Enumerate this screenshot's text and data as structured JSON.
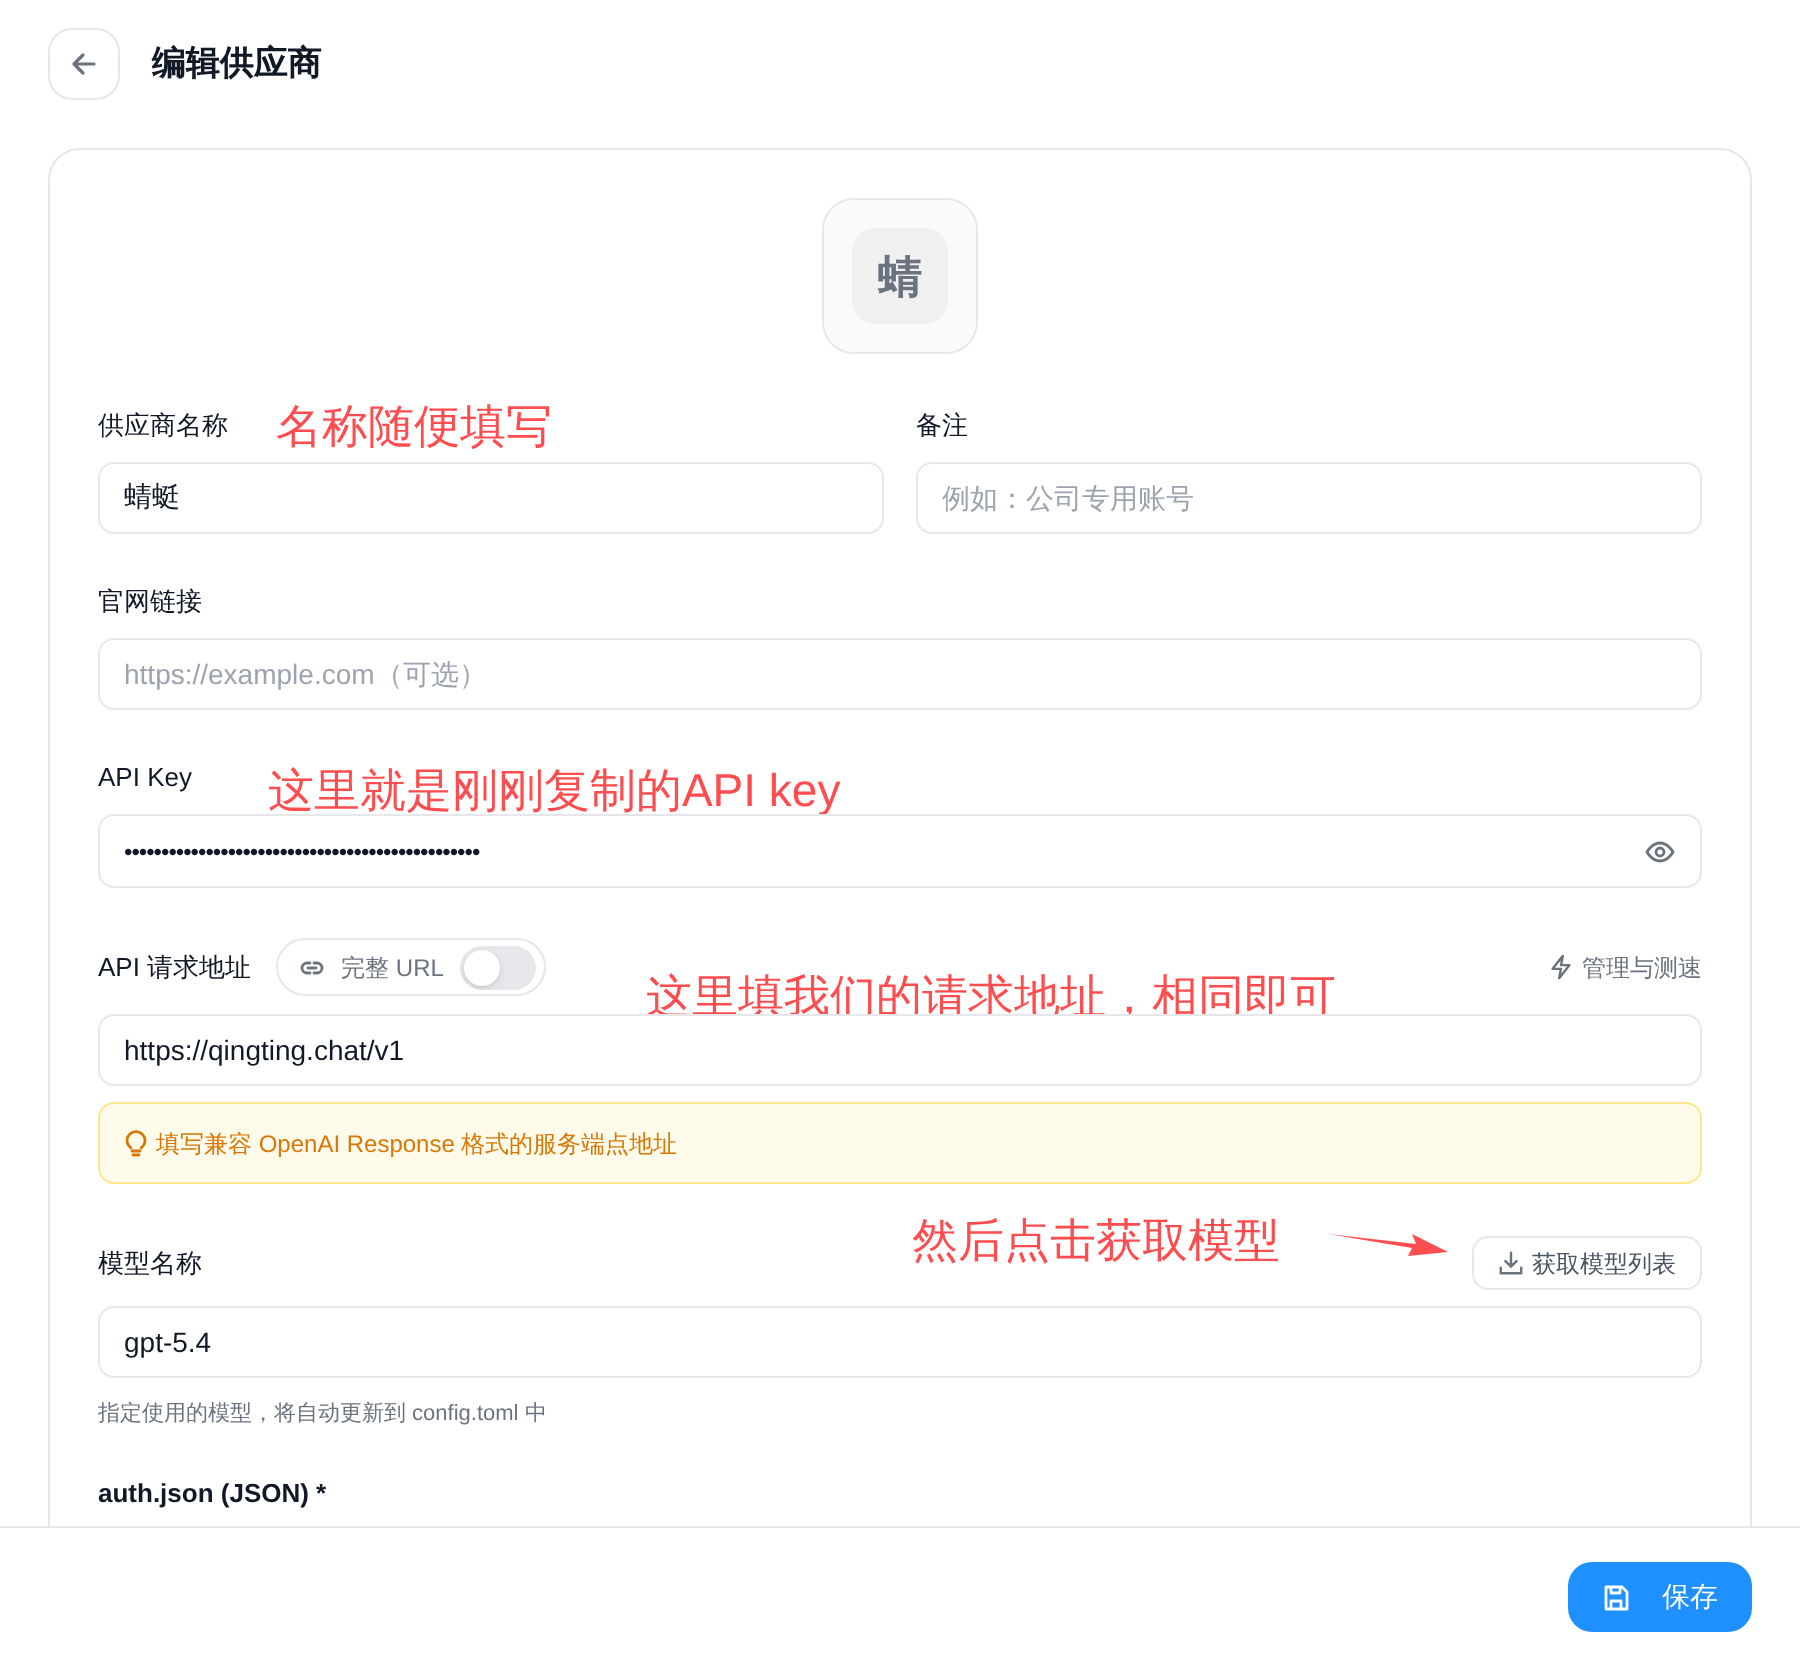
{
  "header": {
    "title": "编辑供应商"
  },
  "avatar": {
    "char": "蜻"
  },
  "fields_row": [
    {
      "label": "供应商名称",
      "value": "蜻蜓"
    },
    {
      "label": "备注",
      "placeholder": "例如：公司专用账号"
    }
  ],
  "website": {
    "label": "官网链接",
    "placeholder": "https://example.com（可选）"
  },
  "api_key": {
    "label": "API Key",
    "value": "••••••••••••••••••••••••••••••••••••••••••••••••"
  },
  "endpoint": {
    "label": "API 请求地址",
    "toggle": {
      "label": "完整 URL",
      "on": false
    },
    "action": "管理与测速",
    "value": "https://qingting.chat/v1",
    "hint": "填写兼容 OpenAI Response 格式的服务端点地址"
  },
  "model": {
    "label": "模型名称",
    "fetch_button": "获取模型列表",
    "value": "gpt-5.4",
    "help": "指定使用的模型，将自动更新到 config.toml 中"
  },
  "next_section": {
    "label": "auth.json (JSON) *"
  },
  "footer": {
    "save_button": "保存"
  },
  "annotations": [
    {
      "text": "名称随便填写"
    },
    {
      "text": "这里就是刚刚复制的API key"
    },
    {
      "text": "这里填我们的请求地址，相同即可"
    },
    {
      "text": "然后点击获取模型"
    }
  ]
}
